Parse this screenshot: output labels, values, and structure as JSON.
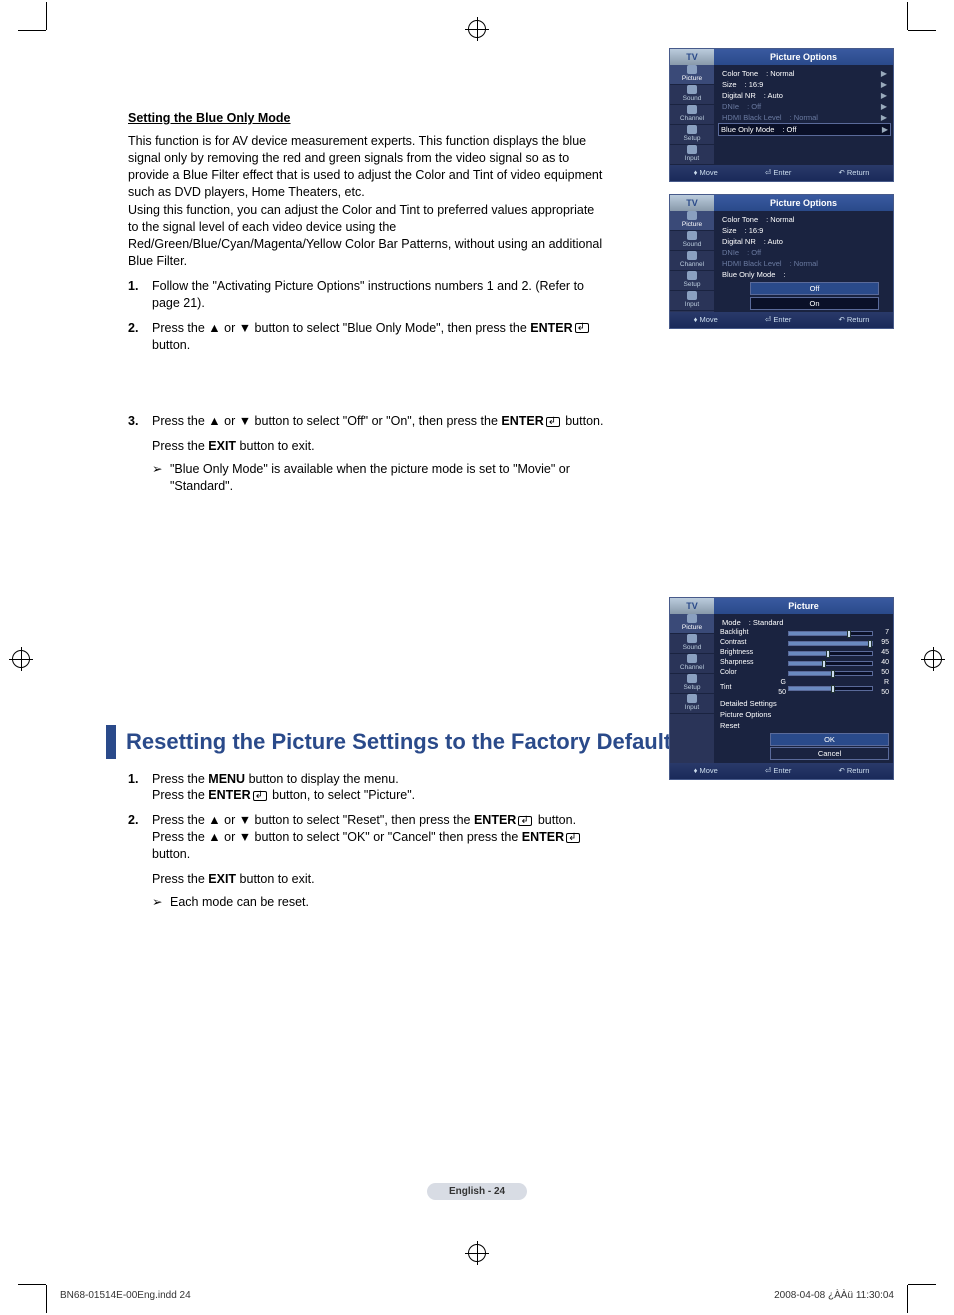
{
  "section1": {
    "title": "Setting the Blue Only Mode",
    "para1": "This function is for AV device measurement experts. This function displays the blue signal only by removing the red and green signals from the video signal so as to provide a Blue Filter effect that is used to adjust the Color and Tint of video equipment such as DVD players, Home Theaters, etc.",
    "para2": "Using this function, you can adjust the Color and Tint to preferred values appropriate to the signal level of each video device using the Red/Green/Blue/Cyan/Magenta/Yellow Color Bar Patterns, without using an additional Blue Filter.",
    "steps": [
      {
        "n": "1.",
        "t": "Follow the \"Activating Picture Options\" instructions numbers 1 and 2. (Refer to page 21)."
      },
      {
        "n": "2.",
        "pre": "Press the ▲ or ▼ button to select \"Blue Only Mode\", then press the ",
        "b": "ENTER",
        "post": " button."
      },
      {
        "n": "3.",
        "pre": "Press the ▲ or ▼ button to select \"Off\" or \"On\", then press the ",
        "b": "ENTER",
        "post": " button.",
        "exit_pre": "Press the ",
        "exit_b": "EXIT",
        "exit_post": " button to exit.",
        "note": "\"Blue Only Mode\" is available when the picture mode is set to \"Movie\" or \"Standard\"."
      }
    ]
  },
  "section2": {
    "heading": "Resetting the Picture Settings to the Factory Defaults",
    "steps": [
      {
        "n": "1.",
        "l1_pre": "Press the ",
        "l1_b": "MENU",
        "l1_post": " button to display the menu.",
        "l2_pre": "Press the ",
        "l2_b": "ENTER",
        "l2_post": " button, to select \"Picture\"."
      },
      {
        "n": "2.",
        "l1_pre": "Press the ▲ or ▼ button to select \"Reset\", then press the ",
        "l1_b": "ENTER",
        "l1_post": " button.",
        "l2_pre": "Press the ▲ or ▼ button to select \"OK\" or \"Cancel\" then press the ",
        "l2_b": "ENTER",
        "l2_post": " button.",
        "exit_pre": "Press the ",
        "exit_b": "EXIT",
        "exit_post": " button to exit.",
        "note": "Each mode can be reset."
      }
    ]
  },
  "osd": {
    "tv": "TV",
    "title1": "Picture Options",
    "title3": "Picture",
    "tabs": [
      "Picture",
      "Sound",
      "Channel",
      "Setup",
      "Input"
    ],
    "footer": {
      "move": "Move",
      "enter": "Enter",
      "return": "Return"
    },
    "box1": {
      "rows": [
        {
          "l": "Color Tone",
          "v": ": Normal"
        },
        {
          "l": "Size",
          "v": ": 16:9"
        },
        {
          "l": "Digital NR",
          "v": ": Auto"
        },
        {
          "l": "DNIe",
          "v": ": Off",
          "dim": true
        },
        {
          "l": "HDMI Black Level",
          "v": ": Normal",
          "dim": true
        },
        {
          "l": "Blue Only Mode",
          "v": ": Off",
          "hl": true
        }
      ]
    },
    "box2": {
      "rows": [
        {
          "l": "Color Tone",
          "v": ": Normal"
        },
        {
          "l": "Size",
          "v": ": 16:9"
        },
        {
          "l": "Digital NR",
          "v": ": Auto"
        },
        {
          "l": "DNIe",
          "v": ": Off",
          "dim": true
        },
        {
          "l": "HDMI Black Level",
          "v": ": Normal",
          "dim": true
        },
        {
          "l": "Blue Only Mode",
          "v": ":"
        }
      ],
      "opts": [
        "Off",
        "On"
      ]
    },
    "box3": {
      "mode": {
        "l": "Mode",
        "v": ": Standard"
      },
      "sliders": [
        {
          "l": "Backlight",
          "v": "7",
          "pct": 70
        },
        {
          "l": "Contrast",
          "v": "95",
          "pct": 95
        },
        {
          "l": "Brightness",
          "v": "45",
          "pct": 45
        },
        {
          "l": "Sharpness",
          "v": "40",
          "pct": 40
        },
        {
          "l": "Color",
          "v": "50",
          "pct": 50
        },
        {
          "l": "Tint",
          "pre": "G 50",
          "v": "R 50",
          "pct": 50
        }
      ],
      "links": [
        "Detailed Settings",
        "Picture Options",
        "Reset"
      ],
      "reset": [
        "OK",
        "Cancel"
      ]
    }
  },
  "footer": {
    "page": "English - 24",
    "file": "BN68-01514E-00Eng.indd   24",
    "date": "2008-04-08   ¿ÀÀü 11:30:04"
  }
}
